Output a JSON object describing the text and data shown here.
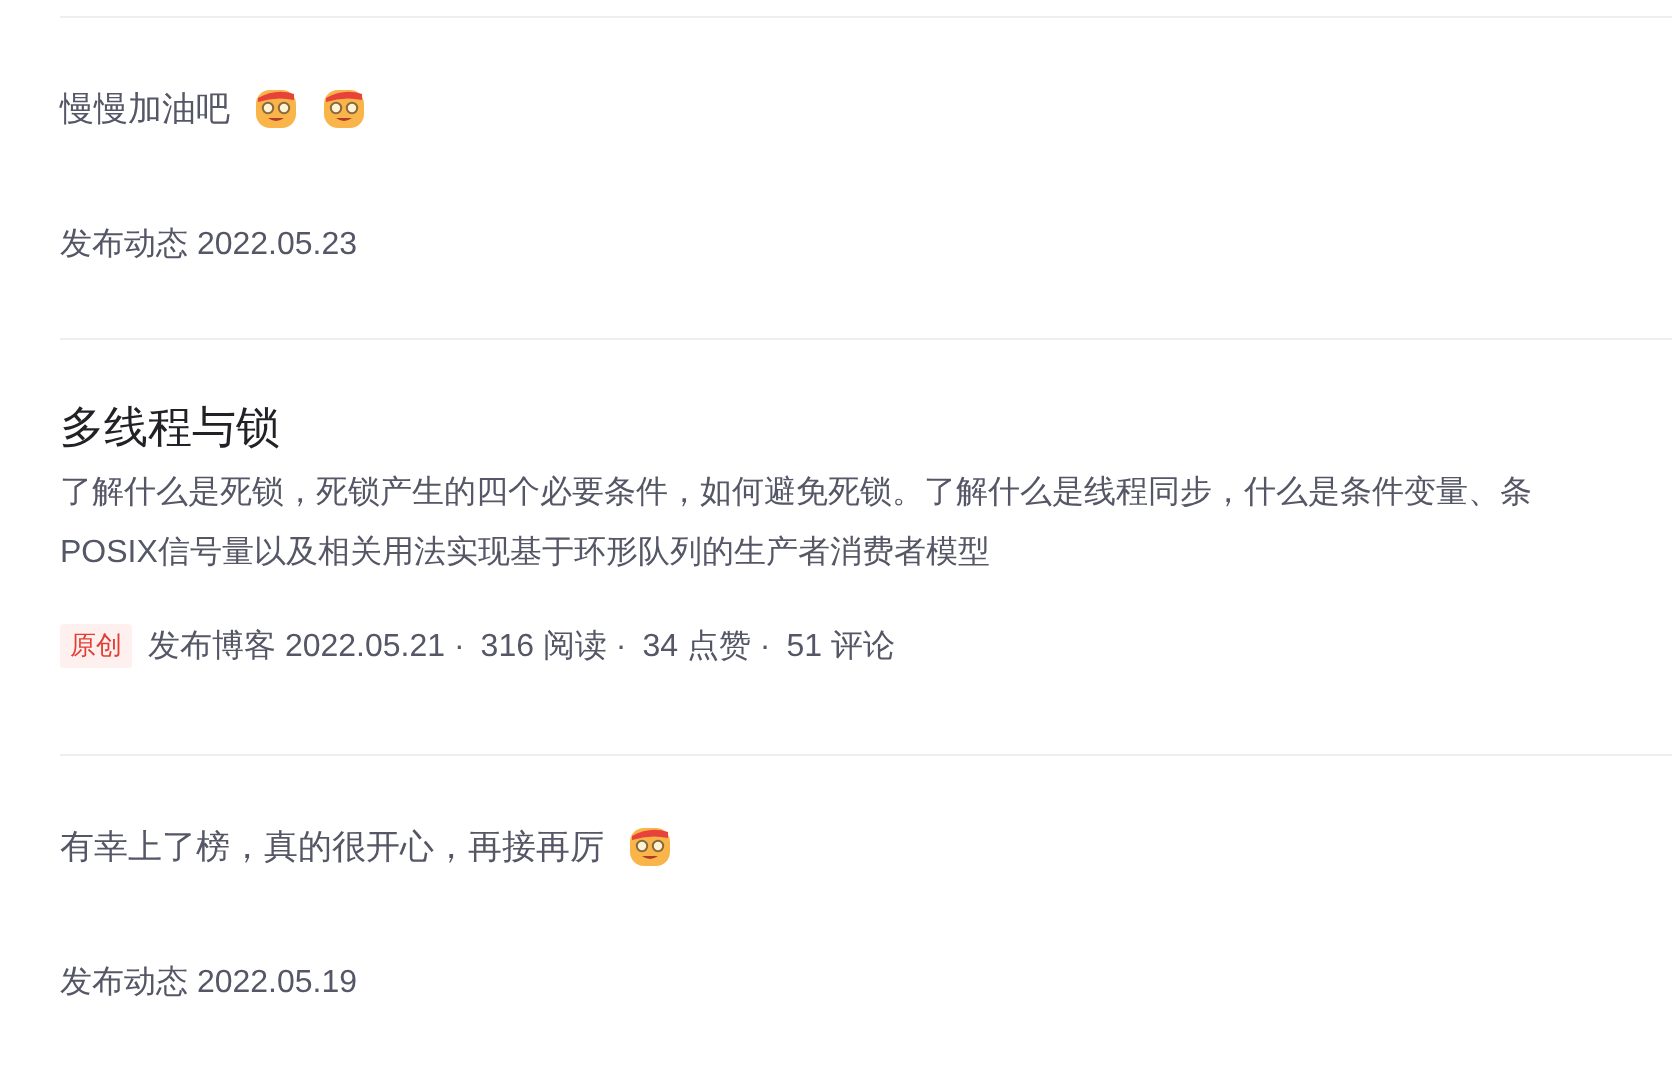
{
  "feed": [
    {
      "kind": "post",
      "text": "慢慢加油吧",
      "emojis": [
        {
          "kind": "emoji"
        },
        {
          "kind": "emoji"
        }
      ],
      "meta": "发布动态 2022.05.23"
    },
    {
      "kind": "blog",
      "title": "多线程与锁",
      "description": "了解什么是死锁，死锁产生的四个必要条件，如何避免死锁。了解什么是线程同步，什么是条件变量、条POSIX信号量以及相关用法实现基于环形队列的生产者消费者模型",
      "badge": "原创",
      "meta": "发布博客 2022.05.21 ·",
      "stats": [
        "316 阅读 ·",
        "34 点赞 ·",
        "51 评论"
      ]
    },
    {
      "kind": "post",
      "text": "有幸上了榜，真的很开心，再接再厉",
      "emojis": [
        {
          "kind": "emoji"
        }
      ],
      "meta": "发布动态 2022.05.19"
    }
  ]
}
